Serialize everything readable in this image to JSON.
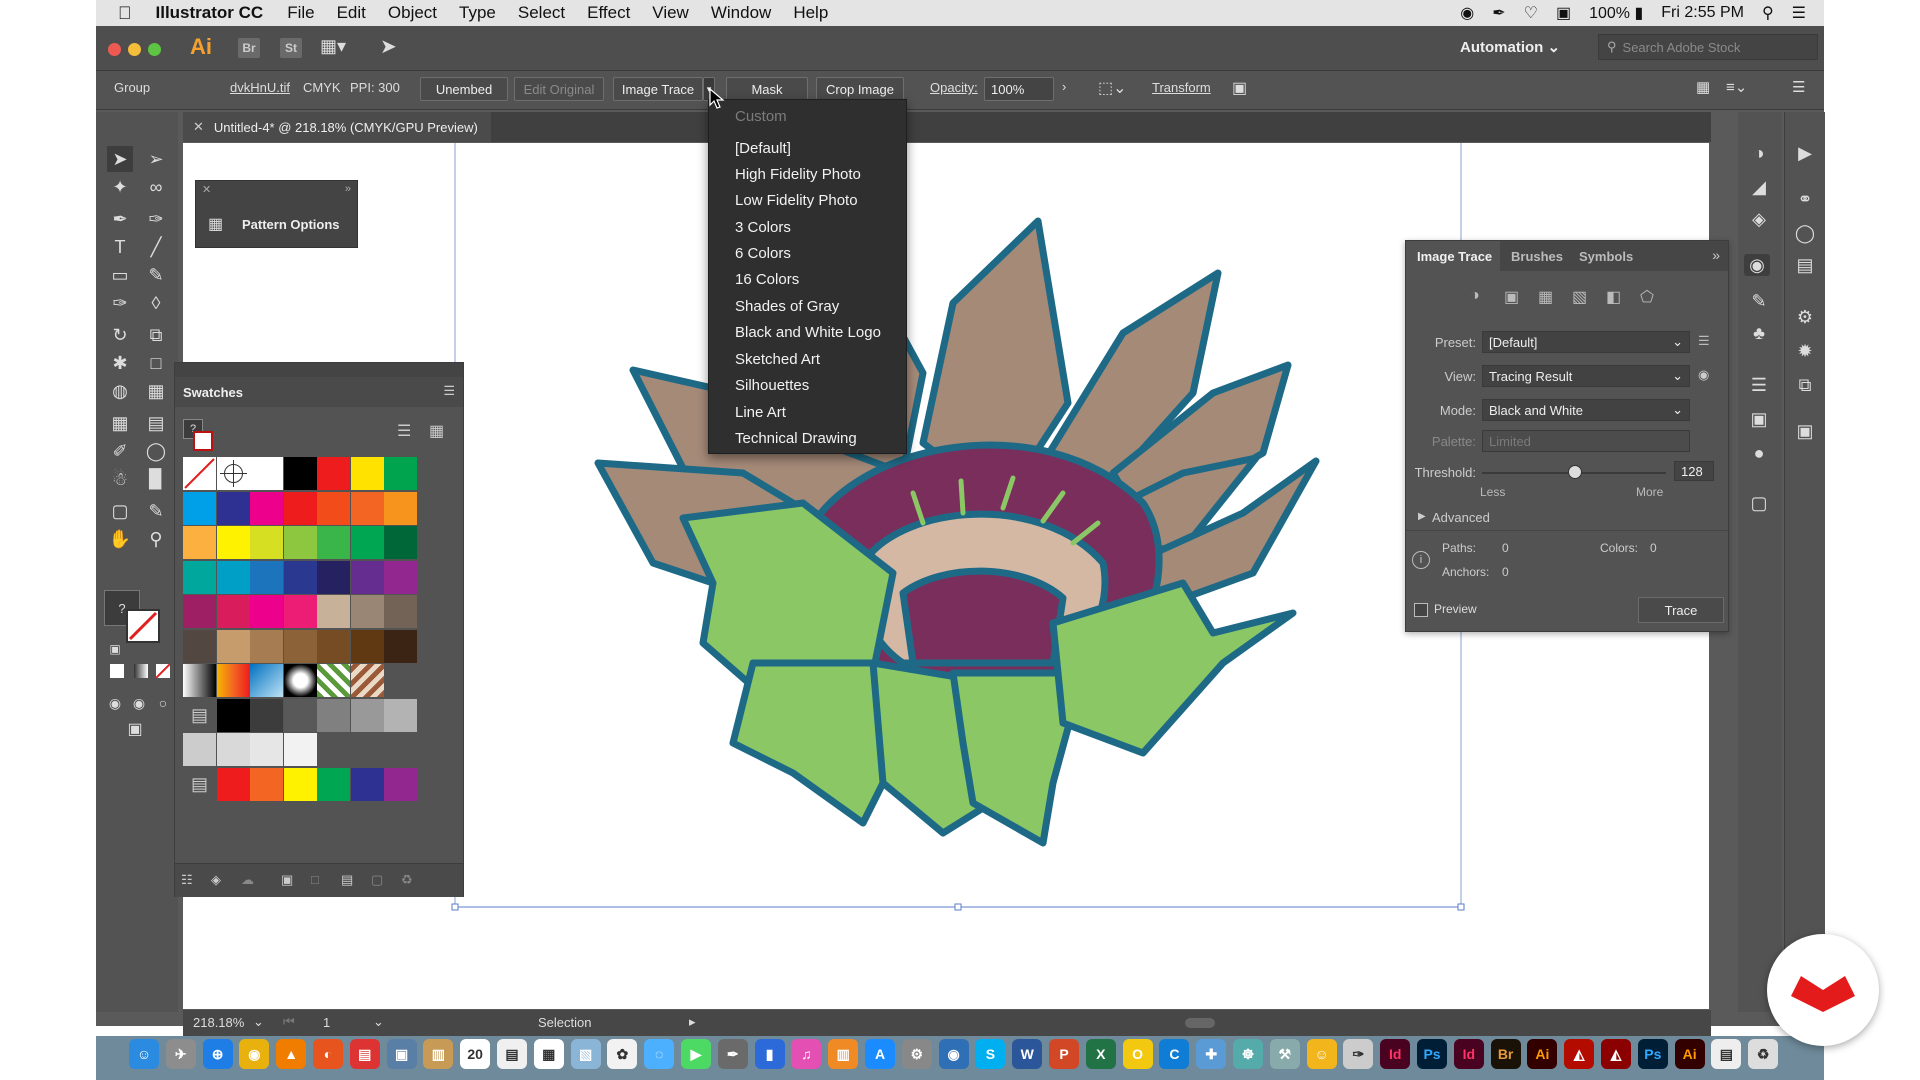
{
  "menubar": {
    "app_name": "Illustrator CC",
    "items": [
      "File",
      "Edit",
      "Object",
      "Type",
      "Select",
      "Effect",
      "View",
      "Window",
      "Help"
    ],
    "battery": "100%",
    "clock": "Fri 2:55 PM"
  },
  "titlebar": {
    "ai_logo": "Ai",
    "br_label": "Br",
    "st_label": "St",
    "workspace": "Automation",
    "search_placeholder": "Search Adobe Stock"
  },
  "controlbar": {
    "selection_type": "Group",
    "filename": "dvkHnU.tif",
    "color_mode": "CMYK",
    "ppi": "PPI: 300",
    "unembed": "Unembed",
    "edit_original": "Edit Original",
    "image_trace": "Image Trace",
    "mask": "Mask",
    "crop_image": "Crop Image",
    "opacity_label": "Opacity:",
    "opacity_value": "100%",
    "transform": "Transform"
  },
  "document": {
    "tab_title": "Untitled-4* @ 218.18% (CMYK/GPU Preview)"
  },
  "pattern_options": {
    "label": "Pattern Options"
  },
  "swatches": {
    "title": "Swatches"
  },
  "preset_dropdown": {
    "custom": "Custom",
    "items": [
      "[Default]",
      "High Fidelity Photo",
      "Low Fidelity Photo",
      "3 Colors",
      "6 Colors",
      "16 Colors",
      "Shades of Gray",
      "Black and White Logo",
      "Sketched Art",
      "Silhouettes",
      "Line Art",
      "Technical Drawing"
    ]
  },
  "image_trace_panel": {
    "tabs": [
      "Image Trace",
      "Brushes",
      "Symbols"
    ],
    "preset_label": "Preset:",
    "preset_value": "[Default]",
    "view_label": "View:",
    "view_value": "Tracing Result",
    "mode_label": "Mode:",
    "mode_value": "Black and White",
    "palette_label": "Palette:",
    "palette_value": "Limited",
    "threshold_label": "Threshold:",
    "threshold_value": "128",
    "threshold_fraction": 0.5,
    "less": "Less",
    "more": "More",
    "advanced": "Advanced",
    "paths_label": "Paths:",
    "paths_value": "0",
    "colors_label": "Colors:",
    "colors_value": "0",
    "anchors_label": "Anchors:",
    "anchors_value": "0",
    "preview_label": "Preview",
    "trace_button": "Trace"
  },
  "statusbar": {
    "zoom": "218.18%",
    "artboard": "1",
    "tool": "Selection"
  },
  "colors": {
    "menubar_bg": "#e4e4e4",
    "panel_bg": "#535353",
    "dropdown_bg": "#2f2f2f",
    "flower_outline": "#1e6a86",
    "petal_brown": "#a58a78",
    "leaf_green": "#8bc865",
    "inner_purple": "#7a2e5c",
    "brand_red": "#e41b1b"
  }
}
